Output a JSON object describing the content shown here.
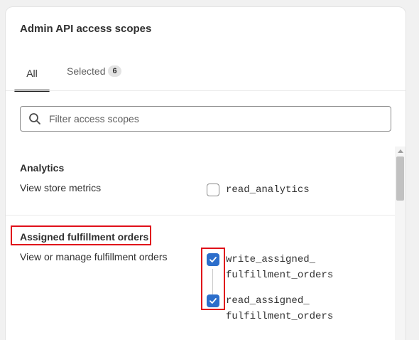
{
  "card": {
    "title": "Admin API access scopes"
  },
  "tabs": [
    {
      "label": "All"
    },
    {
      "label": "Selected",
      "count": "6"
    }
  ],
  "search": {
    "placeholder": "Filter access scopes",
    "value": ""
  },
  "sections": [
    {
      "title": "Analytics",
      "description": "View store metrics",
      "scopes": [
        {
          "name": "read_analytics",
          "checked": false
        }
      ]
    },
    {
      "title": "Assigned fulfillment orders",
      "description": "View or manage fulfillment orders",
      "scopes": [
        {
          "line1": "write_assigned_",
          "line2": "fulfillment_orders",
          "checked": true
        },
        {
          "line1": "read_assigned_",
          "line2": "fulfillment_orders",
          "checked": true
        }
      ]
    }
  ],
  "colors": {
    "checkbox_checked": "#2c6ecb",
    "highlight": "#e0101a",
    "tab_underline": "#1a1a1a"
  },
  "icons": {
    "search": "search-icon",
    "check": "checkmark-icon"
  }
}
